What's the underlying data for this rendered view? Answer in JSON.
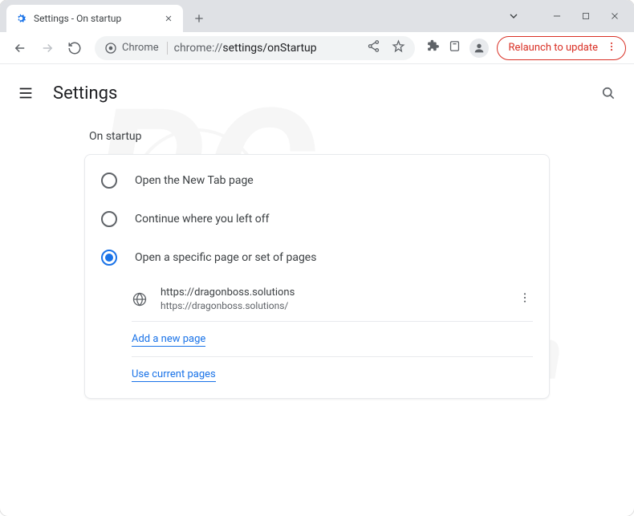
{
  "window": {
    "tab_title": "Settings - On startup"
  },
  "omnibox": {
    "chip_label": "Chrome",
    "url_prefix": "chrome://",
    "url_path": "settings/onStartup"
  },
  "update_button": {
    "label": "Relaunch to update"
  },
  "header": {
    "title": "Settings"
  },
  "section": {
    "title": "On startup",
    "options": [
      {
        "label": "Open the New Tab page"
      },
      {
        "label": "Continue where you left off"
      },
      {
        "label": "Open a specific page or set of pages"
      }
    ],
    "pages": [
      {
        "title": "https://dragonboss.solutions",
        "url": "https://dragonboss.solutions/"
      }
    ],
    "add_link": "Add a new page",
    "use_current_link": "Use current pages"
  }
}
